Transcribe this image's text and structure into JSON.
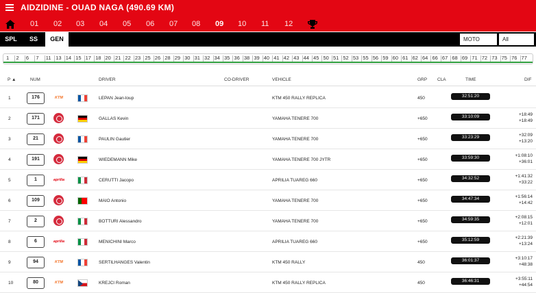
{
  "header": {
    "title": "AIDZIDINE - OUAD NAGA (490.69 KM)",
    "menu_icon": "hamburger-menu-icon",
    "home_icon": "home-icon",
    "trophy_icon": "trophy-icon",
    "stages": [
      "01",
      "02",
      "03",
      "04",
      "05",
      "06",
      "07",
      "08",
      "09",
      "10",
      "11",
      "12"
    ],
    "active_stage": "09",
    "colors": {
      "bar": "#e30613",
      "toolbar": "#000000"
    }
  },
  "toolbar": {
    "tabs": [
      "SPL",
      "SS",
      "GEN"
    ],
    "active_tab": "GEN",
    "category_select": "MOTO",
    "filter_select": "All"
  },
  "waypoints": [
    "1",
    "2",
    "6",
    "7",
    "11",
    "13",
    "14",
    "15",
    "17",
    "18",
    "20",
    "21",
    "22",
    "23",
    "25",
    "26",
    "28",
    "29",
    "30",
    "31",
    "32",
    "34",
    "35",
    "36",
    "38",
    "39",
    "40",
    "41",
    "42",
    "43",
    "44",
    "45",
    "50",
    "51",
    "52",
    "53",
    "55",
    "56",
    "59",
    "60",
    "61",
    "62",
    "64",
    "66",
    "67",
    "68",
    "69",
    "71",
    "72",
    "73",
    "75",
    "76",
    "77"
  ],
  "table": {
    "headers": {
      "pos": "P",
      "num": "NUM",
      "driver": "DRIVER",
      "codriver": "CO-DRIVER",
      "vehicle": "VEHICLE",
      "grp": "GRP",
      "cla": "CLA",
      "time": "TIME",
      "dif": "DIF"
    },
    "rows": [
      {
        "pos": "1",
        "num": "176",
        "brand": "ktm",
        "flag": "fr",
        "driver": "LEPAN Jean-loup",
        "vehicle": "KTM 450 RALLY REPLICA",
        "grp": "450",
        "time": "32:51:20",
        "dif1": "",
        "dif2": ""
      },
      {
        "pos": "2",
        "num": "171",
        "brand": "yamaha",
        "flag": "de",
        "driver": "GALLAS Kevin",
        "vehicle": "YAMAHA TENERE 700",
        "grp": "+650",
        "time": "33:10:09",
        "dif1": "+18:49",
        "dif2": "+18:49"
      },
      {
        "pos": "3",
        "num": "21",
        "brand": "yamaha",
        "flag": "fr",
        "driver": "PAULIN Gautier",
        "vehicle": "YAMAHA TENERE 700",
        "grp": "+650",
        "time": "33:23:29",
        "dif1": "+32:09",
        "dif2": "+13:20"
      },
      {
        "pos": "4",
        "num": "191",
        "brand": "yamaha",
        "flag": "de",
        "driver": "WIEDEMANN Mike",
        "vehicle": "YAMAHA TENERE 700 JYTR",
        "grp": "+650",
        "time": "33:59:30",
        "dif1": "+1:08:10",
        "dif2": "+36:01"
      },
      {
        "pos": "5",
        "num": "1",
        "brand": "aprilia",
        "flag": "it",
        "driver": "CERUTTI Jacopo",
        "vehicle": "APRILIA TUAREG 660",
        "grp": "+650",
        "time": "34:32:52",
        "dif1": "+1:41:32",
        "dif2": "+33:22"
      },
      {
        "pos": "6",
        "num": "109",
        "brand": "yamaha",
        "flag": "pt",
        "driver": "MAIO Antonio",
        "vehicle": "YAMAHA TENERE 700",
        "grp": "+650",
        "time": "34:47:34",
        "dif1": "+1:56:14",
        "dif2": "+14:42"
      },
      {
        "pos": "7",
        "num": "2",
        "brand": "yamaha",
        "flag": "it",
        "driver": "BOTTURI Alessandro",
        "vehicle": "YAMAHA TENERE 700",
        "grp": "+650",
        "time": "34:59:35",
        "dif1": "+2:08:15",
        "dif2": "+12:01"
      },
      {
        "pos": "8",
        "num": "6",
        "brand": "aprilia",
        "flag": "it",
        "driver": "MENICHINI Marco",
        "vehicle": "APRILIA TUAREG 660",
        "grp": "+650",
        "time": "35:12:59",
        "dif1": "+2:21:39",
        "dif2": "+13:24"
      },
      {
        "pos": "9",
        "num": "94",
        "brand": "ktm",
        "flag": "fr",
        "driver": "SERTILHANGES Valentin",
        "vehicle": "KTM 450 RALLY",
        "grp": "450",
        "time": "36:01:37",
        "dif1": "+3:10:17",
        "dif2": "+48:38"
      },
      {
        "pos": "10",
        "num": "80",
        "brand": "ktm",
        "flag": "cz",
        "driver": "KREJCI Roman",
        "vehicle": "KTM 450 RALLY REPLICA",
        "grp": "450",
        "time": "36:46:31",
        "dif1": "+3:55:11",
        "dif2": "+44:54"
      }
    ]
  },
  "brand_labels": {
    "ktm": "KTM",
    "aprilia": "aprilia"
  },
  "flag_colors": {
    "fr": [
      "#0055a4",
      "#ffffff",
      "#ef4135"
    ],
    "de": [
      "#000000",
      "#dd0000",
      "#ffce00"
    ],
    "it": [
      "#009246",
      "#ffffff",
      "#ce2b37"
    ],
    "pt": [
      "#006600",
      "#ff0000",
      "#ff0000"
    ],
    "cz": [
      "#ffffff",
      "#d7141a",
      "#11457e"
    ]
  }
}
